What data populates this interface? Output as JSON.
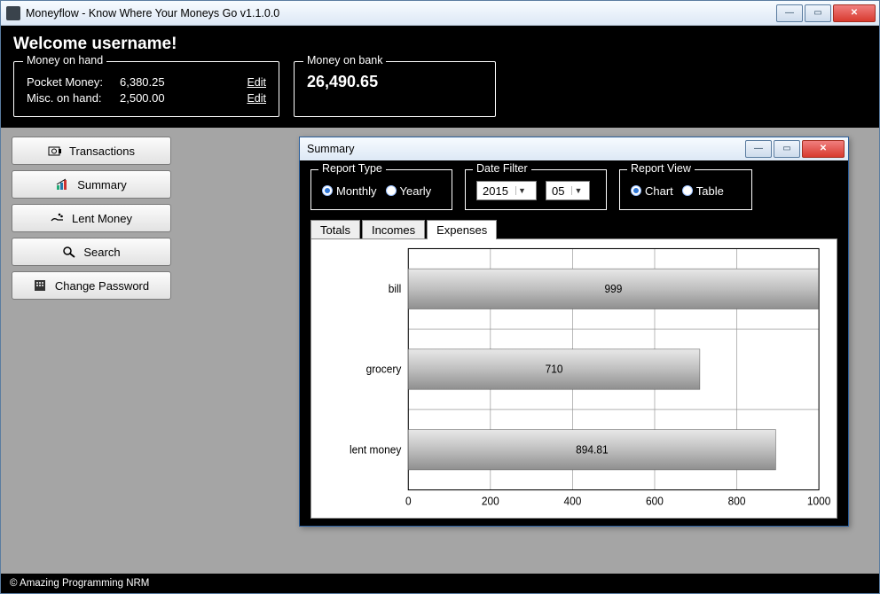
{
  "window": {
    "title": "Moneyflow - Know Where Your Moneys Go v1.1.0.0"
  },
  "welcome": "Welcome username!",
  "money_on_hand": {
    "legend": "Money on hand",
    "rows": [
      {
        "label": "Pocket Money:",
        "value": "6,380.25",
        "edit": "Edit"
      },
      {
        "label": "Misc. on hand:",
        "value": "2,500.00",
        "edit": "Edit"
      }
    ]
  },
  "money_on_bank": {
    "legend": "Money on bank",
    "value": "26,490.65"
  },
  "nav": {
    "transactions": "Transactions",
    "summary": "Summary",
    "lent": "Lent Money",
    "search": "Search",
    "password": "Change Password"
  },
  "summary_win": {
    "title": "Summary",
    "report_type": {
      "legend": "Report Type",
      "monthly": "Monthly",
      "yearly": "Yearly",
      "selected": "Monthly"
    },
    "date_filter": {
      "legend": "Date Filter",
      "year": "2015",
      "month": "05"
    },
    "report_view": {
      "legend": "Report View",
      "chart": "Chart",
      "table": "Table",
      "selected": "Chart"
    },
    "tabs": {
      "totals": "Totals",
      "incomes": "Incomes",
      "expenses": "Expenses",
      "active": "Expenses"
    }
  },
  "chart_data": {
    "type": "bar",
    "orientation": "horizontal",
    "categories": [
      "bill",
      "grocery",
      "lent money"
    ],
    "values": [
      999,
      710,
      894.81
    ],
    "xlim": [
      0,
      1000
    ],
    "xticks": [
      0,
      200,
      400,
      600,
      800,
      1000
    ],
    "title": "",
    "xlabel": "",
    "ylabel": ""
  },
  "footer": "© Amazing Programming NRM"
}
